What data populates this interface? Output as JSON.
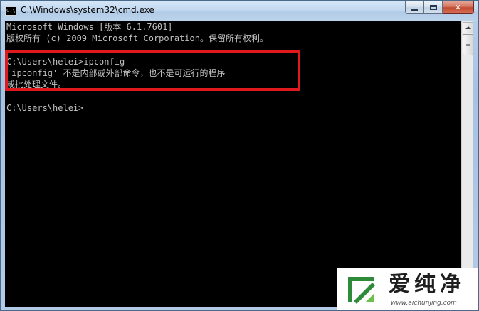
{
  "window": {
    "title": "C:\\Windows\\system32\\cmd.exe",
    "icon": "cmd-icon",
    "icon_text": "C:\\"
  },
  "caption_buttons": {
    "minimize": "minimize-icon",
    "maximize": "maximize-icon",
    "close_label": "✕"
  },
  "console": {
    "lines": [
      "Microsoft Windows [版本 6.1.7601]",
      "版权所有 (c) 2009 Microsoft Corporation。保留所有权利。",
      "",
      "C:\\Users\\helei>ipconfig",
      "'ipconfig' 不是内部或外部命令，也不是可运行的程序",
      "或批处理文件。",
      "",
      "C:\\Users\\helei>"
    ],
    "highlight_color": "#e0191d"
  },
  "watermark": {
    "title": "爱纯净",
    "url": "www.aichunjing.com",
    "logo_color": "#2e8b3a"
  }
}
